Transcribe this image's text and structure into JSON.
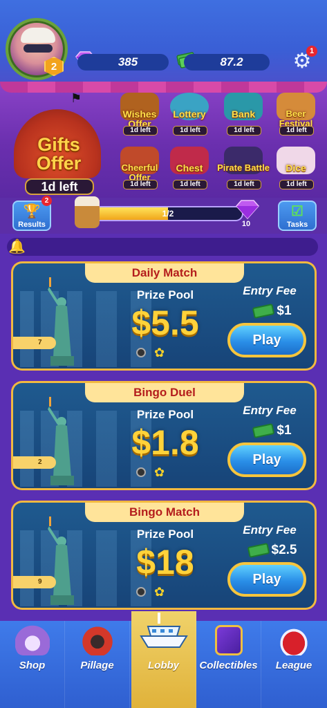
{
  "header": {
    "level": "2",
    "gems": "385",
    "cash": "87.2",
    "settings_badge": "1"
  },
  "events": {
    "featured": {
      "title_line1": "Gifts",
      "title_line2": "Offer",
      "time_left": "1d left"
    },
    "items": [
      {
        "name": "Wishes Offer",
        "time_left": "1d left",
        "color": "#b0621f"
      },
      {
        "name": "Lottery",
        "time_left": "1d left",
        "color": "#3aa3c4"
      },
      {
        "name": "Bank",
        "time_left": "1d left",
        "color": "#2a98a8"
      },
      {
        "name": "Beer Festival",
        "time_left": "1d left",
        "color": "#d58b3a"
      },
      {
        "name": "Cheerful Offer",
        "time_left": "1d left",
        "color": "#c04a2a"
      },
      {
        "name": "Chest",
        "time_left": "1d left",
        "color": "#c02a4a"
      },
      {
        "name": "Pirate Battle",
        "time_left": "1d left",
        "color": "#3b2a6a"
      },
      {
        "name": "Dice",
        "time_left": "1d left",
        "color": "#f0d8e8"
      }
    ]
  },
  "progress": {
    "results_label": "Results",
    "results_badge": "2",
    "bar_text": "1/2",
    "bar_fraction": 0.5,
    "reward_count": "10",
    "tasks_label": "Tasks"
  },
  "matches": [
    {
      "title": "Daily Match",
      "pool_label": "Prize Pool",
      "pool_value": "$5.5",
      "fee_label": "Entry Fee",
      "fee_value": "$1",
      "play_label": "Play",
      "players": "7"
    },
    {
      "title": "Bingo Duel",
      "pool_label": "Prize Pool",
      "pool_value": "$1.8",
      "fee_label": "Entry Fee",
      "fee_value": "$1",
      "play_label": "Play",
      "players": "2"
    },
    {
      "title": "Bingo Match",
      "pool_label": "Prize Pool",
      "pool_value": "$18",
      "fee_label": "Entry Fee",
      "fee_value": "$2.5",
      "play_label": "Play",
      "players": "9"
    }
  ],
  "nav": {
    "items": [
      {
        "label": "Shop",
        "icon": "shell-icon"
      },
      {
        "label": "Pillage",
        "icon": "cannon-icon"
      },
      {
        "label": "Lobby",
        "icon": "ship-icon",
        "active": true
      },
      {
        "label": "Collectibles",
        "icon": "book-icon"
      },
      {
        "label": "League",
        "icon": "pirate-hat-icon"
      }
    ]
  },
  "colors": {
    "header_bg": "#3f6fe0",
    "event_bg": "#6a2fae",
    "card_border": "#f2b940",
    "prize_yellow": "#ffd23a",
    "title_red": "#b41d1d",
    "play_blue": "#2a8fe8"
  }
}
